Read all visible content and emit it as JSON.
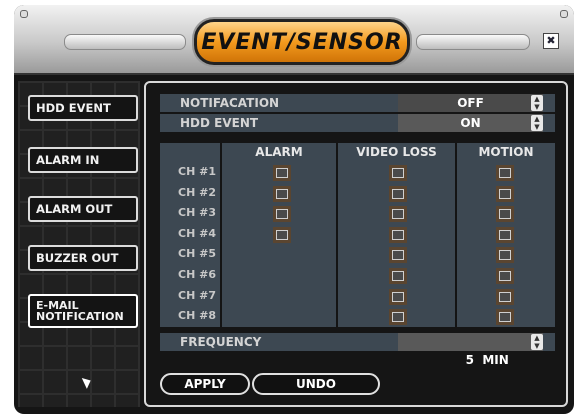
{
  "window": {
    "title": "EVENT/SENSOR",
    "close_glyph": "✖"
  },
  "sidebar": {
    "items": [
      {
        "label": "HDD EVENT"
      },
      {
        "label": "ALARM IN"
      },
      {
        "label": "ALARM OUT"
      },
      {
        "label": "BUZZER OUT"
      },
      {
        "label": "E-MAIL NOTIFICATION",
        "active": true
      }
    ]
  },
  "settings": {
    "notification": {
      "label": "NOTIFACATION",
      "value": "OFF"
    },
    "hdd_event": {
      "label": "HDD EVENT",
      "value": "ON"
    },
    "frequency": {
      "label": "FREQUENCY",
      "value": "5  MIN"
    }
  },
  "grid": {
    "columns": [
      "ALARM",
      "VIDEO LOSS",
      "MOTION"
    ],
    "channels": [
      "CH #1",
      "CH #2",
      "CH #3",
      "CH #4",
      "CH #5",
      "CH #6",
      "CH #7",
      "CH #8"
    ],
    "alarm_channels_available": 4
  },
  "buttons": {
    "apply": "APPLY",
    "undo": "UNDO"
  },
  "icons": {
    "spinner": "up-down-spinner-icon",
    "cursor": "pointer-cursor-icon"
  }
}
